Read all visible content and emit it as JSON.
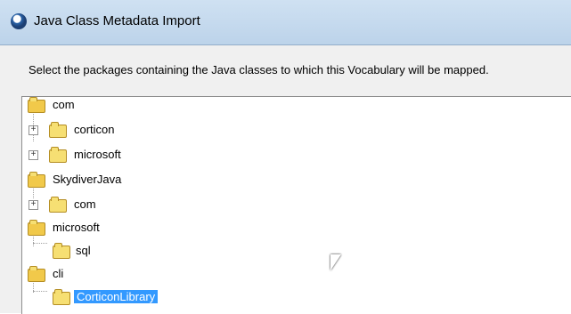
{
  "window": {
    "title": "Java Class Metadata Import"
  },
  "instruction": "Select the packages containing the Java classes to which this Vocabulary will be mapped.",
  "tree": [
    {
      "label": "com"
    },
    {
      "label": "corticon"
    },
    {
      "label": "microsoft"
    },
    {
      "label": "SkydiverJava"
    },
    {
      "label": "com"
    },
    {
      "label": "microsoft"
    },
    {
      "label": "sql"
    },
    {
      "label": "cli"
    },
    {
      "label": "CorticonLibrary"
    }
  ]
}
